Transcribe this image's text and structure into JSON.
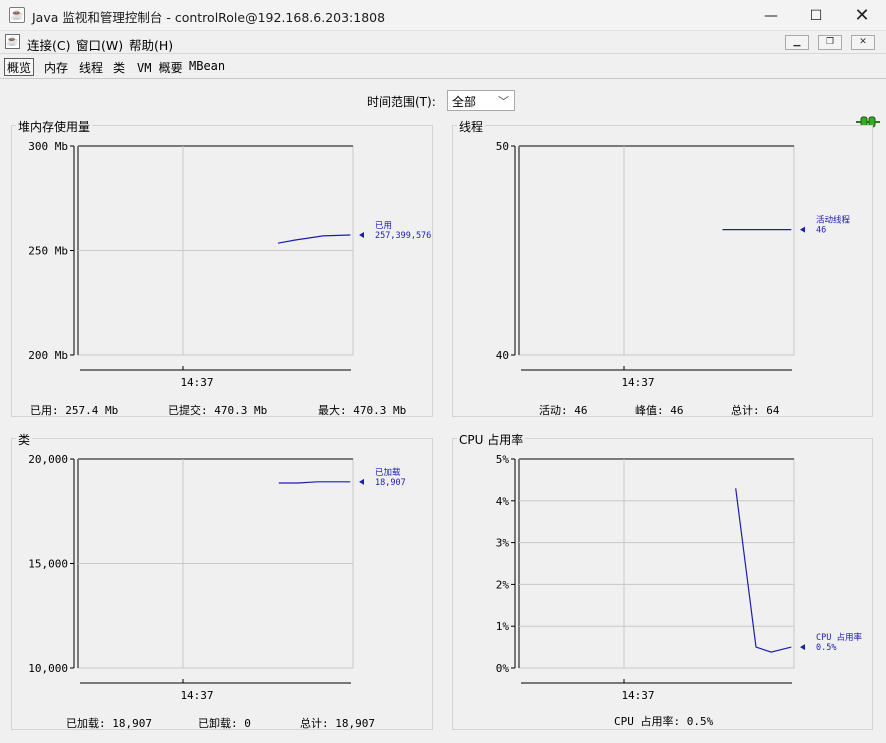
{
  "window": {
    "title": "Java 监视和管理控制台 - controlRole@192.168.6.203:1808"
  },
  "menu": [
    "连接(C)",
    "窗口(W)",
    "帮助(H)"
  ],
  "tabs": [
    "概览",
    "内存",
    "线程",
    "类",
    "VM 概要",
    "MBean"
  ],
  "active_tab": 0,
  "time_range": {
    "label": "时间范围(T):",
    "value": "全部"
  },
  "panels": {
    "heap": {
      "title": "堆内存使用量",
      "footer": [
        "已用:  257.4  Mb",
        "已提交:  470.3  Mb",
        "最大:  470.3  Mb"
      ]
    },
    "threads": {
      "title": "线程",
      "footer": [
        "活动:  46",
        "峰值:  46",
        "总计:  64"
      ]
    },
    "classes": {
      "title": "类",
      "footer": [
        "已加载:  18,907",
        "已卸载:  0",
        "总计:  18,907"
      ]
    },
    "cpu": {
      "title": "CPU 占用率",
      "footer": [
        "CPU 占用率: 0.5%"
      ]
    }
  },
  "chart_data": [
    {
      "type": "line",
      "title": "堆内存使用量",
      "x_tick_labels": [
        "14:37"
      ],
      "y_tick_labels": [
        "300 Mb",
        "250 Mb",
        "200 Mb"
      ],
      "ylim": [
        200,
        300
      ],
      "color": "#1c1cb4",
      "series": [
        {
          "name": "已用",
          "value_label": "257,399,576",
          "x": [
            0.727,
            0.79,
            0.84,
            0.89,
            0.99
          ],
          "y": [
            253.5,
            255,
            256,
            257,
            257.4
          ]
        }
      ]
    },
    {
      "type": "line",
      "title": "线程",
      "x_tick_labels": [
        "14:37"
      ],
      "y_tick_labels": [
        "50",
        "40"
      ],
      "ylim": [
        40,
        50
      ],
      "color": "#1c1cb4",
      "series": [
        {
          "name": "活动线程",
          "value_label": "46",
          "x": [
            0.74,
            0.99
          ],
          "y": [
            46,
            46
          ]
        }
      ]
    },
    {
      "type": "line",
      "title": "类",
      "x_tick_labels": [
        "14:37"
      ],
      "y_tick_labels": [
        "20,000",
        "15,000",
        "10,000"
      ],
      "ylim": [
        10000,
        20000
      ],
      "color": "#1c1cb4",
      "series": [
        {
          "name": "已加载",
          "value_label": "18,907",
          "x": [
            0.73,
            0.8,
            0.87,
            0.99
          ],
          "y": [
            18850,
            18850,
            18907,
            18907
          ]
        }
      ]
    },
    {
      "type": "line",
      "title": "CPU 占用率",
      "x_tick_labels": [
        "14:37"
      ],
      "y_tick_labels": [
        "5%",
        "4%",
        "3%",
        "2%",
        "1%",
        "0%"
      ],
      "ylim": [
        0,
        5
      ],
      "color": "#1c1cb4",
      "series": [
        {
          "name": "CPU 占用率",
          "value_label": "0.5%",
          "x": [
            0.788,
            0.862,
            0.917,
            0.99
          ],
          "y": [
            4.3,
            0.5,
            0.38,
            0.5
          ]
        }
      ]
    }
  ]
}
